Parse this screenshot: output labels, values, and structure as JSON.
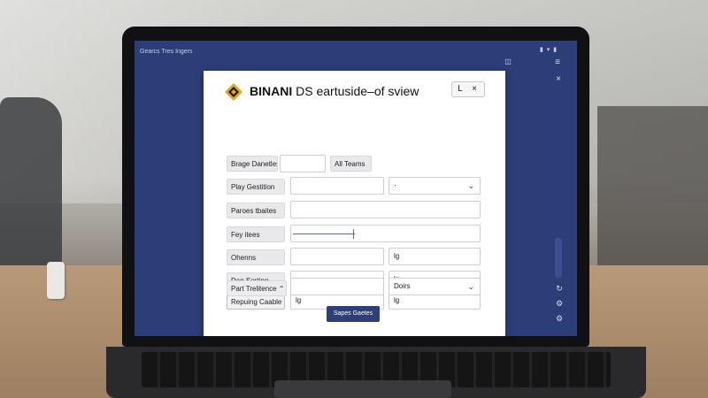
{
  "window": {
    "title": "Gearcs Tres Ingers",
    "status_tray": "▮ ▾ ▮"
  },
  "dialog": {
    "brand": "BINANI",
    "title_rest": " DS eartuside–of sview",
    "minimize_label": "L",
    "close_label": "×"
  },
  "header_row": {
    "left_button": "Brage Danetles",
    "right_button": "All Teams"
  },
  "rows": [
    {
      "label": "Play Gestition",
      "value": "",
      "select_value": "·"
    },
    {
      "label": "Paroes tbaites",
      "value": ""
    },
    {
      "label": "Fey itees",
      "value": ""
    },
    {
      "label": "Ohenns",
      "value": "",
      "unit": "lg"
    },
    {
      "label": "Dep Sorting",
      "value": "",
      "unit": "lg"
    },
    {
      "label": "Repuing Caable",
      "value": "lg",
      "unit": "lg"
    },
    {
      "label": "Part Trelitence",
      "value": "",
      "select_value": "Doirs"
    }
  ],
  "submit_label": "Sapes Gaetes",
  "colors": {
    "screen_bg": "#2c3e78",
    "primary": "#2d3f79",
    "logo": "#e2a51b"
  },
  "icons": [
    "logo-diamond-icon",
    "minimize-icon",
    "close-icon",
    "menu-icon",
    "side-close-icon",
    "refresh-icon",
    "settings-icon",
    "chevron-down-icon"
  ]
}
